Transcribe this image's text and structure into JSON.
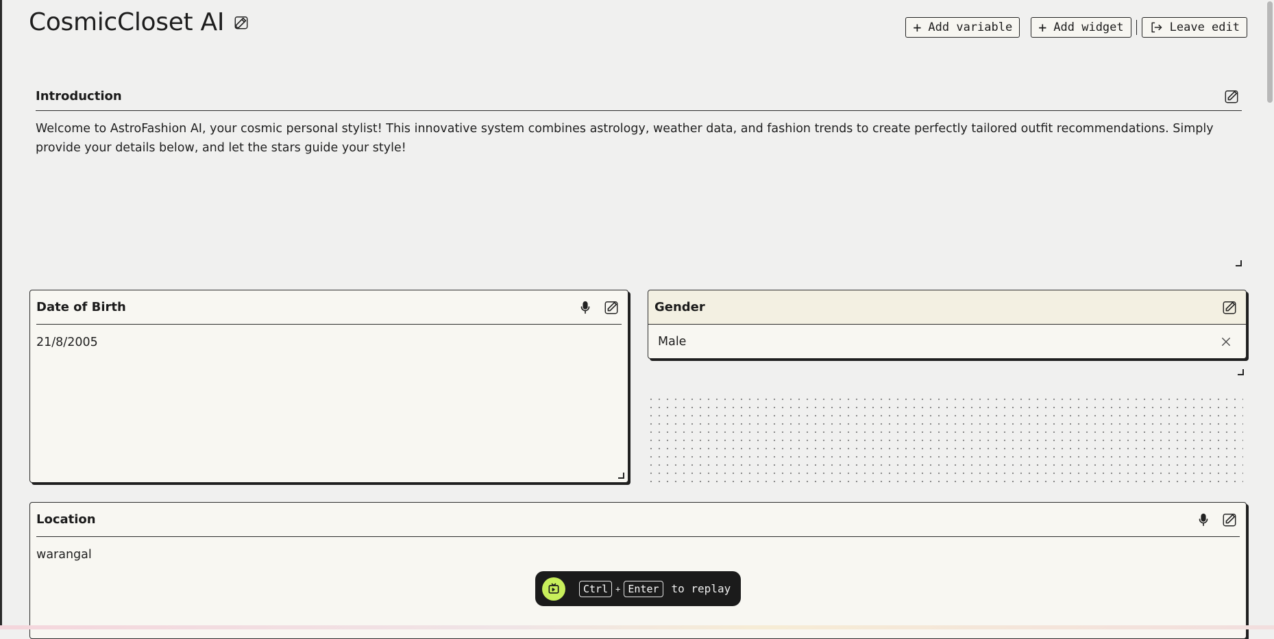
{
  "header": {
    "title": "CosmicCloset AI",
    "add_variable_label": "Add variable",
    "add_widget_label": "Add widget",
    "leave_edit_label": "Leave edit"
  },
  "intro": {
    "label": "Introduction",
    "text": "Welcome to AstroFashion AI, your cosmic personal stylist! This innovative system combines astrology, weather data, and fashion trends to create perfectly tailored outfit recommendations. Simply provide your details below, and let the stars guide your style!"
  },
  "dob": {
    "label": "Date of Birth",
    "value": "21/8/2005"
  },
  "gender": {
    "label": "Gender",
    "value": "Male"
  },
  "location": {
    "label": "Location",
    "value": "warangal"
  },
  "replay": {
    "key1": "Ctrl",
    "plus": "+",
    "key2": "Enter",
    "suffix": "to replay"
  },
  "colors": {
    "accent": "#c8ef5b",
    "card_bg": "#f8f7f2",
    "page_bg": "#f0f0ef",
    "gender_head_bg": "#f3f0e2"
  }
}
